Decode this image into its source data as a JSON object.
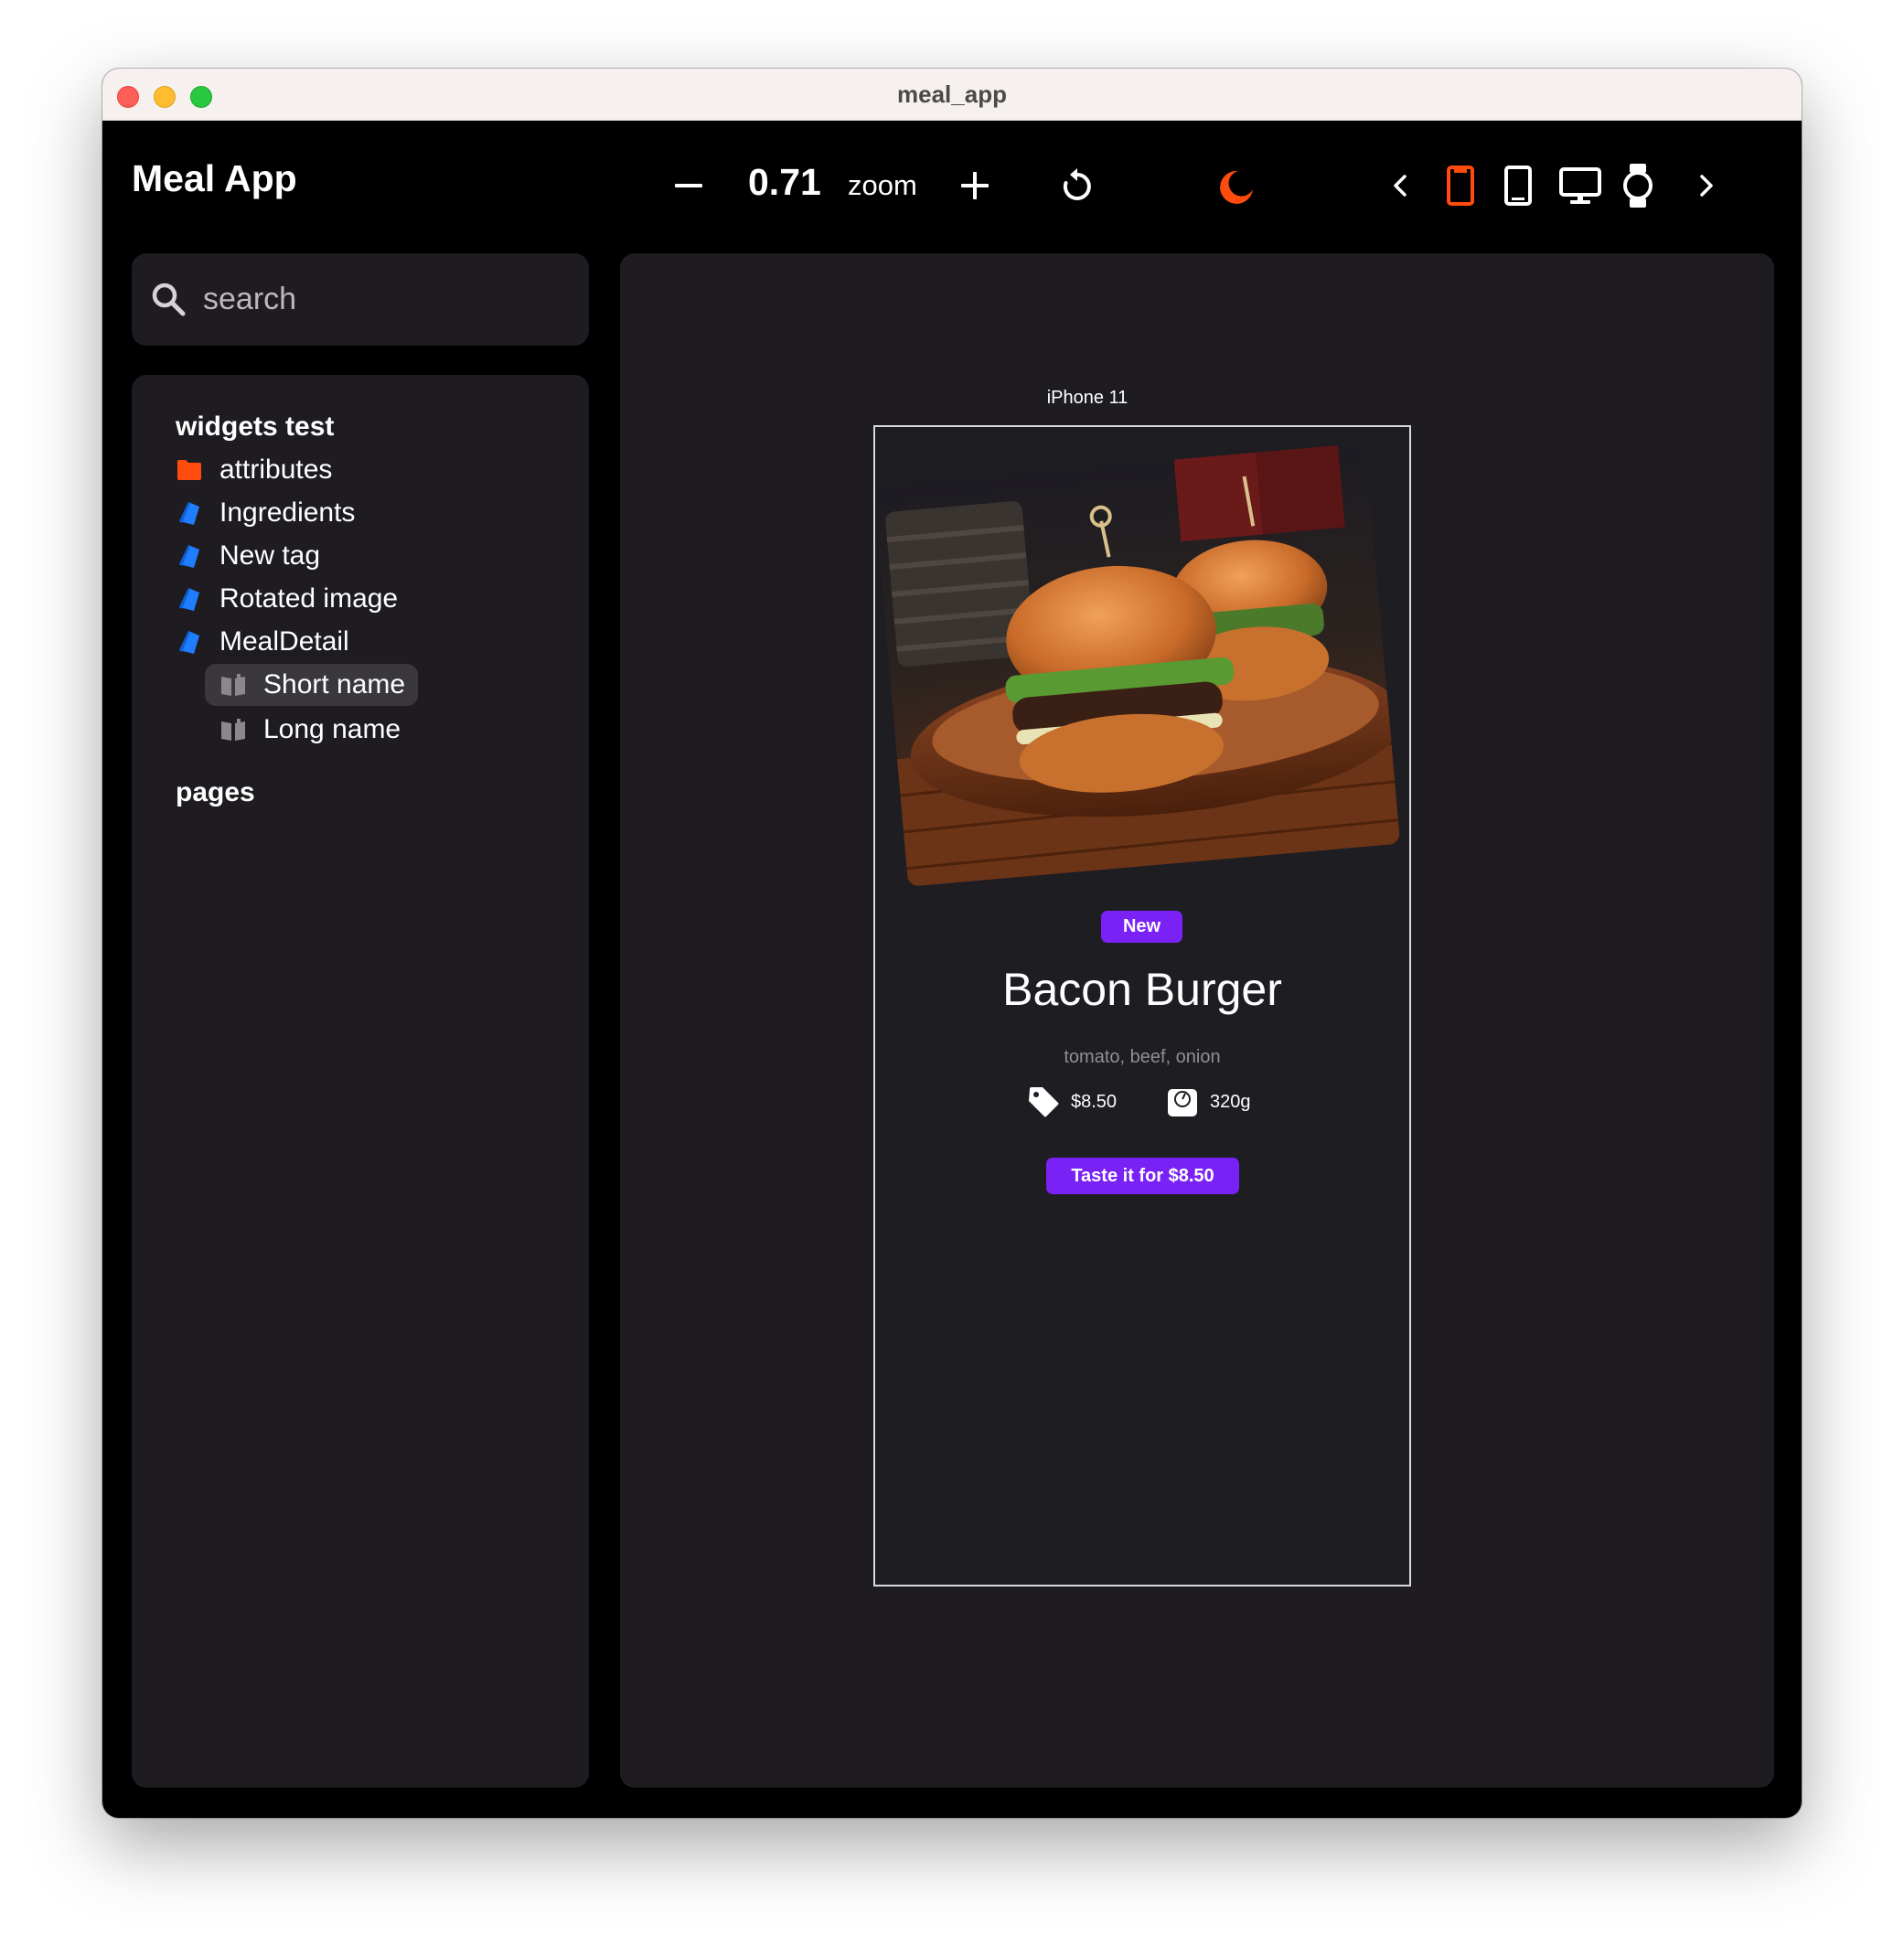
{
  "window": {
    "title": "meal_app"
  },
  "toolbar": {
    "app_title": "Meal App",
    "zoom_value": "0.71",
    "zoom_label": "zoom",
    "accent_color": "#ff4b0d"
  },
  "search": {
    "placeholder": "search",
    "value": ""
  },
  "tree": {
    "sections": [
      {
        "label": "widgets test"
      },
      {
        "label": "pages"
      }
    ],
    "items": [
      {
        "label": "attributes",
        "icon": "folder-icon"
      },
      {
        "label": "Ingredients",
        "icon": "widget-icon"
      },
      {
        "label": "New tag",
        "icon": "widget-icon"
      },
      {
        "label": "Rotated image",
        "icon": "widget-icon"
      },
      {
        "label": "MealDetail",
        "icon": "widget-icon"
      },
      {
        "label": "Short name",
        "icon": "book-icon",
        "selected": true
      },
      {
        "label": "Long name",
        "icon": "book-icon"
      }
    ]
  },
  "preview": {
    "device_label": "iPhone 11",
    "meal": {
      "badge": "New",
      "name": "Bacon Burger",
      "ingredients": "tomato, beef, onion",
      "price": "$8.50",
      "weight": "320g",
      "cta": "Taste it for $8.50",
      "accent_color": "#7a22f5"
    }
  }
}
